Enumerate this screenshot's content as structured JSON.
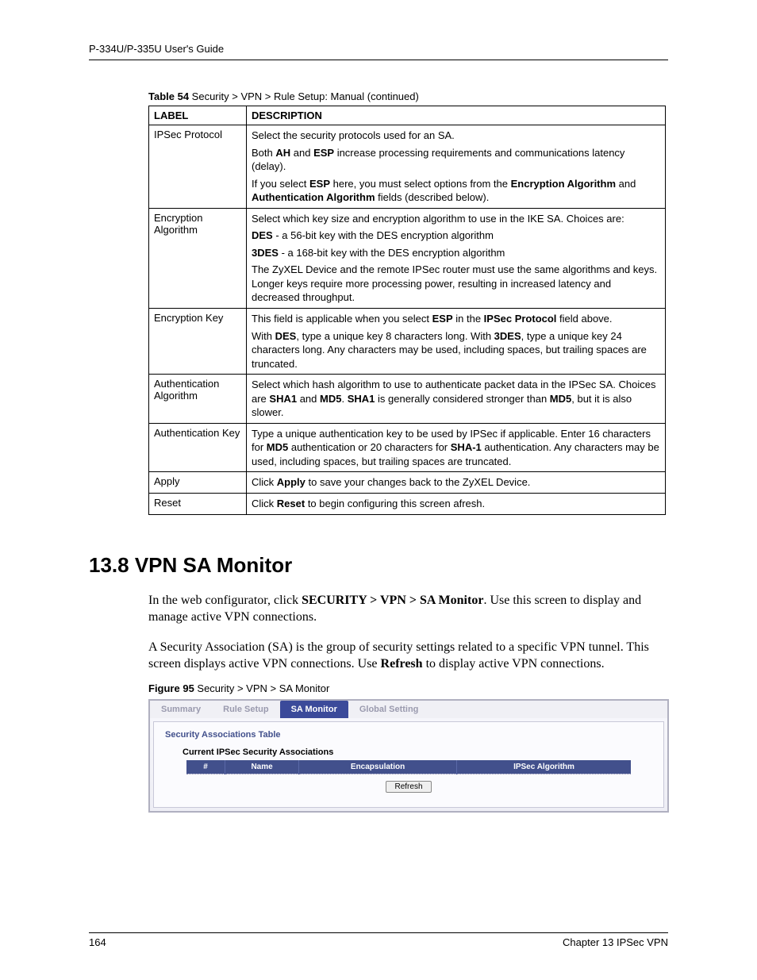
{
  "header": {
    "text": "P-334U/P-335U User's Guide"
  },
  "table_caption": {
    "bold": "Table 54",
    "rest": "   Security > VPN > Rule Setup: Manual (continued)"
  },
  "table": {
    "head": {
      "label": "LABEL",
      "desc": "DESCRIPTION"
    },
    "rows": [
      {
        "label": "IPSec Protocol",
        "desc": [
          [
            {
              "t": "Select the security protocols used for an SA."
            }
          ],
          [
            {
              "t": "Both "
            },
            {
              "b": "AH"
            },
            {
              "t": " and "
            },
            {
              "b": "ESP"
            },
            {
              "t": " increase processing requirements and communications latency (delay)."
            }
          ],
          [
            {
              "t": "If you select "
            },
            {
              "b": "ESP"
            },
            {
              "t": " here, you must select options from the "
            },
            {
              "b": "Encryption Algorithm"
            },
            {
              "t": " and "
            },
            {
              "b": "Authentication Algorithm"
            },
            {
              "t": " fields (described below)."
            }
          ]
        ]
      },
      {
        "label": "Encryption Algorithm",
        "desc": [
          [
            {
              "t": "Select which key size and encryption algorithm to use in the IKE SA. Choices are:"
            }
          ],
          [
            {
              "b": "DES"
            },
            {
              "t": " - a 56-bit key with the DES encryption algorithm"
            }
          ],
          [
            {
              "b": "3DES"
            },
            {
              "t": " - a 168-bit key with the DES encryption algorithm"
            }
          ],
          [
            {
              "t": "The ZyXEL Device and the remote IPSec router must use the same algorithms and keys. Longer keys require more processing power, resulting in increased latency and decreased throughput."
            }
          ]
        ]
      },
      {
        "label": "Encryption Key",
        "desc": [
          [
            {
              "t": "This field is applicable when you select "
            },
            {
              "b": "ESP"
            },
            {
              "t": " in the "
            },
            {
              "b": "IPSec Protocol"
            },
            {
              "t": " field above."
            }
          ],
          [
            {
              "t": "With "
            },
            {
              "b": "DES"
            },
            {
              "t": ", type a unique key 8 characters long. With "
            },
            {
              "b": "3DES"
            },
            {
              "t": ", type a unique key 24 characters long. Any characters may be used, including spaces, but trailing spaces are truncated."
            }
          ]
        ]
      },
      {
        "label": "Authentication Algorithm",
        "desc": [
          [
            {
              "t": "Select which hash algorithm to use to authenticate packet data in the IPSec SA. Choices are "
            },
            {
              "b": "SHA1"
            },
            {
              "t": " and "
            },
            {
              "b": "MD5"
            },
            {
              "t": ". "
            },
            {
              "b": "SHA1"
            },
            {
              "t": " is generally considered stronger than "
            },
            {
              "b": "MD5"
            },
            {
              "t": ", but it is also slower."
            }
          ]
        ]
      },
      {
        "label": "Authentication Key",
        "desc": [
          [
            {
              "t": "Type a unique authentication key to be used by IPSec if applicable. Enter 16 characters for "
            },
            {
              "b": "MD5"
            },
            {
              "t": " authentication or 20 characters for "
            },
            {
              "b": "SHA-1"
            },
            {
              "t": " authentication. Any characters may be used, including spaces, but trailing spaces are truncated."
            }
          ]
        ]
      },
      {
        "label": "Apply",
        "desc": [
          [
            {
              "t": "Click "
            },
            {
              "b": "Apply"
            },
            {
              "t": " to save your changes back to the ZyXEL Device."
            }
          ]
        ]
      },
      {
        "label": "Reset",
        "desc": [
          [
            {
              "t": "Click "
            },
            {
              "b": "Reset"
            },
            {
              "t": " to begin configuring this screen afresh."
            }
          ]
        ]
      }
    ]
  },
  "section": {
    "heading": "13.8  VPN SA Monitor"
  },
  "para1": [
    {
      "t": "In the web configurator, click "
    },
    {
      "b": "SECURITY > VPN > SA Monitor"
    },
    {
      "t": ". Use this screen to display and manage active VPN connections."
    }
  ],
  "para2": [
    {
      "t": "A Security Association (SA) is the group of security settings related to a specific VPN tunnel. This screen displays active VPN connections. Use "
    },
    {
      "b": "Refresh"
    },
    {
      "t": " to display active VPN connections."
    }
  ],
  "figure_caption": {
    "bold": "Figure 95",
    "rest": "   Security > VPN > SA Monitor"
  },
  "screenshot": {
    "tabs": [
      "Summary",
      "Rule Setup",
      "SA Monitor",
      "Global Setting"
    ],
    "active_tab_index": 2,
    "panel_title": "Security Associations Table",
    "sub_title": "Current IPSec Security Associations",
    "columns": [
      "#",
      "Name",
      "Encapsulation",
      "IPSec Algorithm"
    ],
    "refresh_label": "Refresh"
  },
  "footer": {
    "page": "164",
    "chapter": "Chapter 13 IPSec VPN"
  }
}
